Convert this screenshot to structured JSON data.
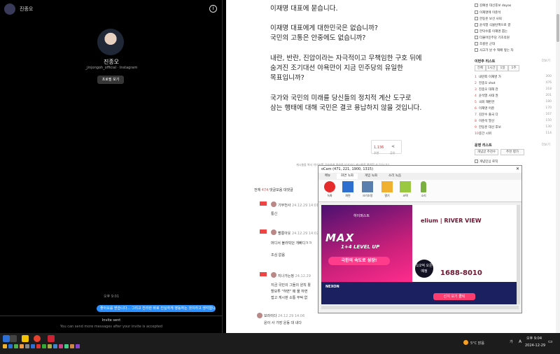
{
  "dm": {
    "username": "진종오",
    "handle": "_jinjongoh_official · Instagram",
    "profile_button": "프로필 보기",
    "time": "오후 9:01",
    "message": "좋아요를 받습니다... 그리고 진리란 바로 진실하게 행동하는 것이라고 생각합니다.",
    "invite_title": "Invite sent",
    "invite_sub": "You can send more messages after your invite is accepted"
  },
  "article": {
    "lines": [
      "이재명 대표에 묻습니다.",
      "이재명 대표에게 대한민국은 없습니까?",
      "국민의 고통은 안중에도 없습니까?",
      "내란, 반란, 진압이라는 자극적이고 무책임한 구호 뒤에",
      "숨겨진 조기대선 야욕만이 지금 민주당의 유일한",
      "목표입니까?",
      "국가와 국민의 미래를 당신들의 정치적 계산 도구로",
      "삼는 행태에 대해 국민은 결코 용납하지 않을 것입니다."
    ],
    "like_count": "1,136",
    "like_label": "추천",
    "share_label": "공유",
    "note": "게시물을 복사 이미지를 공유하여 댓글을 남기거나 게시물을 열람할 수 있습니다."
  },
  "sidebar": {
    "top_items": [
      "김예성 대선후보 dayas",
      "이재명에 이준석",
      "한동훈 보선 사퇴",
      "윤석열 식물탄핵으로 결",
      "한덕수를 이재명 뽑는",
      "더불어민주당 기초의원",
      "조롱된 군대",
      "사고가 날 수 택배 앞는 차"
    ],
    "rank_title": "이번주 리스트",
    "rank_more": "더보기",
    "tabs": [
      "전체",
      "1시간",
      "1일",
      "1주"
    ],
    "rank_items": [
      {
        "n": "1",
        "t": "내란죄 이재명 가",
        "v": "300"
      },
      {
        "n": "2",
        "t": "진종오 shot",
        "v": "476"
      },
      {
        "n": "3",
        "t": "진종오 대해 관",
        "v": "318"
      },
      {
        "n": "4",
        "t": "윤석열 사태 권",
        "v": "201"
      },
      {
        "n": "5",
        "t": "국회 재판관",
        "v": "180"
      },
      {
        "n": "6",
        "t": "이재명 어준",
        "v": "170"
      },
      {
        "n": "7",
        "t": "김문수 출국 다",
        "v": "167"
      },
      {
        "n": "8",
        "t": "이준석 열선",
        "v": "150"
      },
      {
        "n": "9",
        "t": "한동훈 대선 후보",
        "v": "130"
      },
      {
        "n": "10",
        "t": "중간 시위",
        "v": "114"
      }
    ],
    "ops_title": "운영 리스트",
    "ops_more": "더보기",
    "ops_tabs": [
      "개념글 추천수",
      "추천 평가"
    ],
    "ops_item": "개념민심 로직"
  },
  "comments": {
    "tabs": [
      "전체",
      "댓글모음",
      "대댓글"
    ],
    "count": "474",
    "items": [
      {
        "name": "기부천사",
        "date": "24.12.29 14:01",
        "text": "통신"
      },
      {
        "name": "빨릉아웃",
        "date": "24.12.29 14:02",
        "text": "머디서 불라빅던 개빠디ㅋㅋ"
      },
      {
        "name": "",
        "date": "",
        "text": "조심 없음"
      },
      {
        "name": "지나가는정",
        "date": "24.12.29",
        "text": "지금 국민의 그들의 원칙 활"
      },
      {
        "name": "",
        "date": "",
        "text": "할보투 \"하면\" 때 물 하면"
      },
      {
        "name": "",
        "date": "",
        "text": "접고 게시판 소통 부탁 없"
      },
      {
        "name": "보라이다",
        "date": "24.12.29 14:06",
        "text": "윤이 사 가장 운동 대 내다"
      }
    ]
  },
  "ocam": {
    "title": "oCam (471, 221, 1900, 1315)",
    "menus": [
      "메뉴",
      "화면 녹화",
      "게임 녹화",
      "소리 녹음"
    ],
    "tools": [
      "녹화",
      "화면",
      "크기조정",
      "열기",
      "코덱",
      "소리"
    ]
  },
  "ad": {
    "brand": "하이퍼스트",
    "headline": "MAX",
    "sub": "1+4 LEVEL UP",
    "speed": "극한의 속도로 성장!",
    "elium": "elium | RIVER VIEW",
    "badge": "1/2억 오픈 예정",
    "phone": "1688-8010",
    "nexon": "NEXON",
    "button": "신지 보기 클릭"
  },
  "taskbar": {
    "weather": "5°C 맑음",
    "time": "오후 9:04",
    "date": "2024-12-29",
    "ime": "A",
    "ime2": "가"
  }
}
